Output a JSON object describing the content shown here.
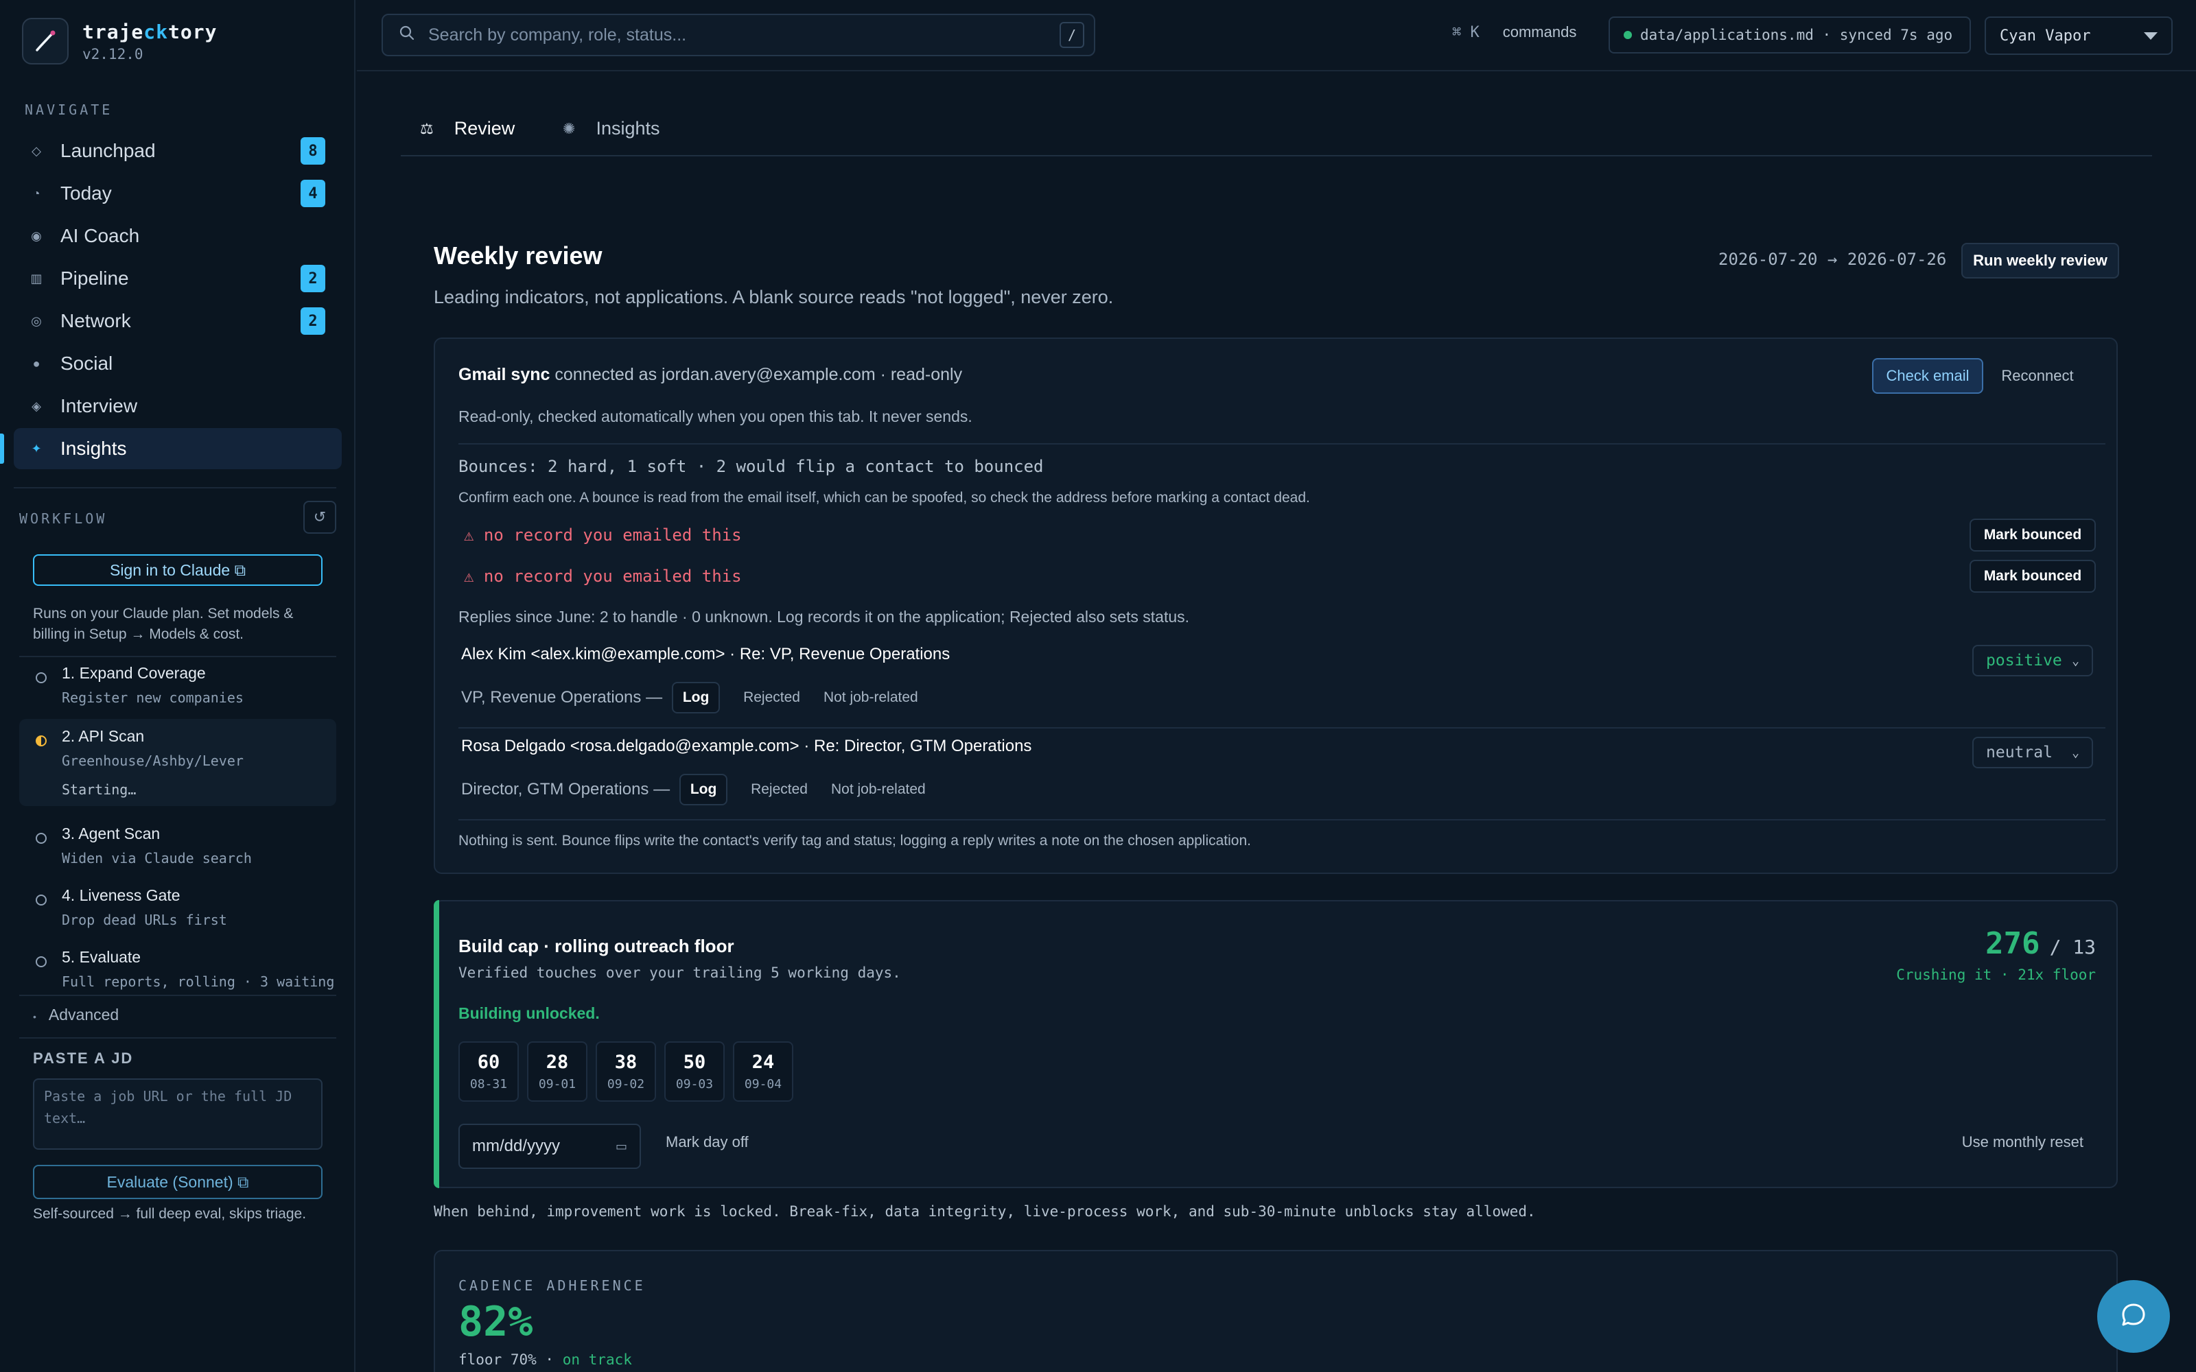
{
  "app": {
    "name_prefix": "traje",
    "name_accent": "ck",
    "name_suffix": "tory",
    "version": "v2.12.0"
  },
  "sidebar": {
    "navigate_label": "NAVIGATE",
    "items": [
      {
        "label": "Launchpad",
        "icon": "diamond-icon",
        "badge": "8"
      },
      {
        "label": "Today",
        "icon": "clock-icon",
        "badge": "4"
      },
      {
        "label": "AI Coach",
        "icon": "target-icon",
        "badge": ""
      },
      {
        "label": "Pipeline",
        "icon": "columns-icon",
        "badge": "2"
      },
      {
        "label": "Network",
        "icon": "ring-icon",
        "badge": "2"
      },
      {
        "label": "Social",
        "icon": "circle-icon",
        "badge": ""
      },
      {
        "label": "Interview",
        "icon": "diamond-dot-icon",
        "badge": ""
      },
      {
        "label": "Insights",
        "icon": "sparkle-icon",
        "badge": "",
        "active": true
      }
    ],
    "workflow_label": "WORKFLOW",
    "signin_label": "Sign in to Claude ⧉",
    "plan_note": "Runs on your Claude plan. Set models & billing in Setup → Models & cost.",
    "steps": [
      {
        "title": "1. Expand Coverage",
        "sub": "Register new companies",
        "state": "idle"
      },
      {
        "title": "2. API Scan",
        "sub": "Greenhouse/Ashby/Lever",
        "status": "Starting…",
        "state": "running"
      },
      {
        "title": "3. Agent Scan",
        "sub": "Widen via Claude search",
        "state": "idle"
      },
      {
        "title": "4. Liveness Gate",
        "sub": "Drop dead URLs first",
        "state": "idle"
      },
      {
        "title": "5. Evaluate",
        "sub": "Full reports, rolling · 3 waiting",
        "state": "idle"
      }
    ],
    "advanced_label": "Advanced",
    "paste_label": "PASTE A JD",
    "paste_placeholder": "Paste a job URL or the full JD text…",
    "evaluate_label": "Evaluate (Sonnet) ⧉",
    "evaluate_note": "Self-sourced → full deep eval, skips triage."
  },
  "topbar": {
    "search_placeholder": "Search by company, role, status...",
    "search_kbd": "/",
    "cmd_key": "⌘ K",
    "cmd_label": "commands",
    "sync_text": "data/applications.md · synced 7s ago",
    "theme": "Cyan Vapor"
  },
  "tabs": [
    {
      "label": "Review",
      "icon": "scale-icon",
      "active": true
    },
    {
      "label": "Insights",
      "icon": "sparkle-icon",
      "active": false
    }
  ],
  "review": {
    "title": "Weekly review",
    "subtitle": "Leading indicators, not applications. A blank source reads \"not logged\", never zero.",
    "date_range": "2026-07-20 → 2026-07-26",
    "run_label": "Run weekly review"
  },
  "gmail": {
    "title": "Gmail sync",
    "status": "connected as jordan.avery@example.com · read-only",
    "check_label": "Check email",
    "reconnect_label": "Reconnect",
    "note": "Read-only, checked automatically when you open this tab. It never sends.",
    "bounces_summary": "Bounces: 2 hard, 1 soft · 2 would flip a contact to bounced",
    "bounces_note": "Confirm each one. A bounce is read from the email itself, which can be spoofed, so check the address before marking a contact dead.",
    "bounce_rows": [
      {
        "warning": "⚠ no record you emailed this",
        "action": "Mark bounced"
      },
      {
        "warning": "⚠ no record you emailed this",
        "action": "Mark bounced"
      }
    ],
    "replies_summary": "Replies since June: 2 to handle · 0 unknown. Log records it on the application; Rejected also sets status.",
    "replies": [
      {
        "from": "Alex Kim <alex.kim@example.com> · Re: VP, Revenue Operations",
        "role": "VP, Revenue Operations —",
        "sentiment": "positive",
        "sentiment_color": "#2fb97a"
      },
      {
        "from": "Rosa Delgado <rosa.delgado@example.com> · Re: Director, GTM Operations",
        "role": "Director, GTM Operations —",
        "sentiment": "neutral",
        "sentiment_color": "#a9b7c6"
      }
    ],
    "reply_actions": {
      "log": "Log",
      "rejected": "Rejected",
      "not_job": "Not job-related"
    },
    "footer": "Nothing is sent. Bounce flips write the contact's verify tag and status; logging a reply writes a note on the chosen application."
  },
  "build_cap": {
    "title": "Build cap · rolling outreach floor",
    "subtitle": "Verified touches over your trailing 5 working days.",
    "score": "276",
    "floor": "/ 13",
    "status": "Crushing it · 21x floor",
    "unlocked": "Building unlocked.",
    "days": [
      {
        "n": "60",
        "d": "08-31"
      },
      {
        "n": "28",
        "d": "09-01"
      },
      {
        "n": "38",
        "d": "09-02"
      },
      {
        "n": "50",
        "d": "09-03"
      },
      {
        "n": "24",
        "d": "09-04"
      }
    ],
    "date_placeholder": "mm/dd/yyyy",
    "dayoff_label": "Mark day off",
    "monthly_label": "Use monthly reset"
  },
  "policy_note": "When behind, improvement work is locked. Break-fix, data integrity, live-process work, and sub-30-minute unblocks stay allowed.",
  "cadence": {
    "label": "CADENCE ADHERENCE",
    "value": "82%",
    "floor": "floor 70% ·",
    "status": "on track"
  },
  "colors": {
    "accent": "#38bdf8",
    "success": "#2fb97a",
    "danger": "#f06b7a",
    "warning": "#f5b93a"
  }
}
